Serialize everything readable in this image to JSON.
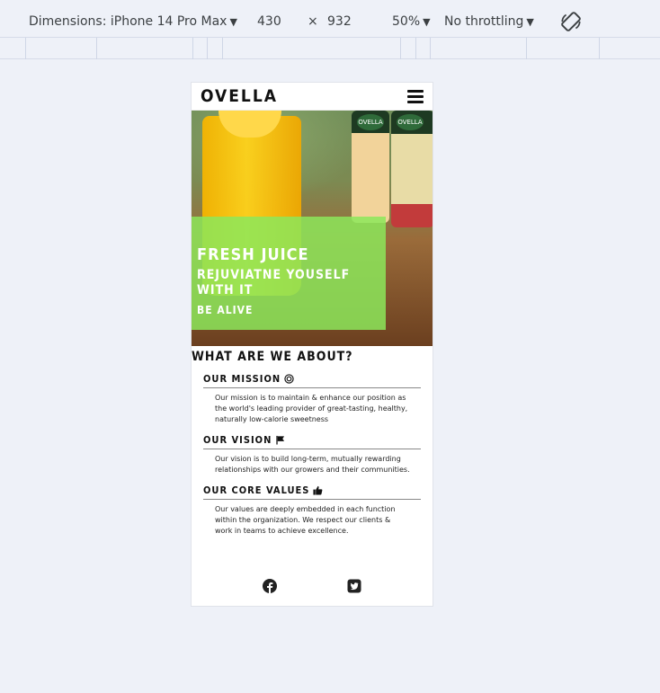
{
  "devtools": {
    "dimensions_label": "Dimensions: iPhone 14 Pro Max",
    "width": "430",
    "times": "×",
    "height": "932",
    "zoom": "50%",
    "throttle": "No throttling",
    "icons": [
      "caret-down-icon",
      "rotate-icon"
    ]
  },
  "nav": {
    "brand": "OVELLA",
    "menu_icon": "hamburger-icon"
  },
  "hero": {
    "bottle_label_1": "OVELLA",
    "bottle_label_2": "OVELLA",
    "title": "FRESH JUICE",
    "subtitle": "REJUVIATNE YOUSELF WITH IT",
    "tagline": "BE ALIVE",
    "overlay_color": "#8ce85a"
  },
  "about": {
    "heading": "WHAT ARE WE ABOUT?",
    "items": [
      {
        "title": "OUR MISSION",
        "icon": "target-icon",
        "text": "Our mission is to maintain & enhance our position as the world's leading provider of great-tasting, healthy, naturally low-calorie sweetness"
      },
      {
        "title": "OUR VISION",
        "icon": "flag-icon",
        "text": "Our vision is to build long-term, mutually rewarding relationships with our growers and their communities."
      },
      {
        "title": "OUR CORE VALUES",
        "icon": "thumbs-up-icon",
        "text": "Our values are deeply embedded in each function within the organization. We respect our clients & work in teams to achieve excellence."
      }
    ]
  },
  "footer": {
    "social": [
      "facebook-icon",
      "twitter-icon"
    ]
  }
}
